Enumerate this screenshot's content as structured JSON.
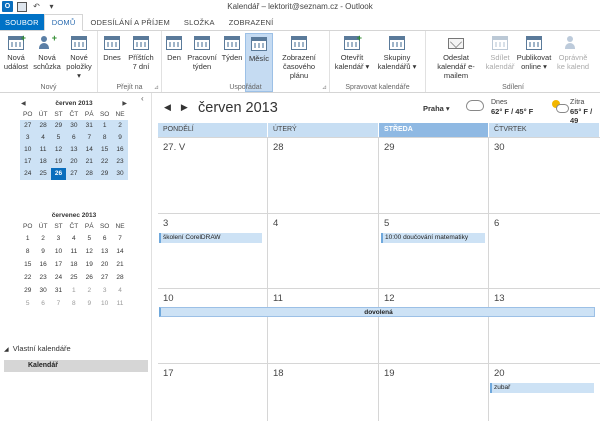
{
  "window": {
    "title": "Kalendář – lektorit@seznam.cz - Outlook"
  },
  "quick_access": {
    "undo_glyph": "↶",
    "dropdown_glyph": "▾"
  },
  "ribbon_tabs": [
    {
      "label": "SOUBOR"
    },
    {
      "label": "DOMŮ"
    },
    {
      "label": "ODESÍLÁNÍ A PŘÍJEM"
    },
    {
      "label": "SLOŽKA"
    },
    {
      "label": "ZOBRAZENÍ"
    }
  ],
  "ribbon": {
    "new": {
      "label": "Nový",
      "new_event": "Nová událost",
      "new_meeting": "Nová schůzka",
      "new_items": "Nové položky ▾"
    },
    "goto": {
      "label": "Přejít na",
      "today": "Dnes",
      "next7": "Příštích 7 dní"
    },
    "arrange": {
      "label": "Uspořádat",
      "day": "Den",
      "work_week": "Pracovní týden",
      "week": "Týden",
      "month": "Měsíc",
      "schedule": "Zobrazení časového plánu"
    },
    "manage": {
      "label": "Spravovat kalendáře",
      "open": "Otevřít kalendář ▾",
      "groups": "Skupiny kalendářů ▾"
    },
    "share": {
      "label": "Sdílení",
      "email": "Odeslat kalendář e-mailem",
      "share": "Sdílet kalendář",
      "publish": "Publikovat online ▾",
      "permissions": "Oprávně ke kalend"
    }
  },
  "mini_cal_1": {
    "title": "červen 2013",
    "prev": "◀",
    "next": "▶",
    "days": [
      "PO",
      "ÚT",
      "ST",
      "ČT",
      "PÁ",
      "SO",
      "NE"
    ],
    "weeks": [
      [
        "27",
        "28",
        "29",
        "30",
        "31",
        "1",
        "2"
      ],
      [
        "3",
        "4",
        "5",
        "6",
        "7",
        "8",
        "9"
      ],
      [
        "10",
        "11",
        "12",
        "13",
        "14",
        "15",
        "16"
      ],
      [
        "17",
        "18",
        "19",
        "20",
        "21",
        "22",
        "23"
      ],
      [
        "24",
        "25",
        "26",
        "27",
        "28",
        "29",
        "30"
      ]
    ]
  },
  "mini_cal_2": {
    "title": "červenec 2013",
    "days": [
      "PO",
      "ÚT",
      "ST",
      "ČT",
      "PÁ",
      "SO",
      "NE"
    ],
    "weeks": [
      [
        "1",
        "2",
        "3",
        "4",
        "5",
        "6",
        "7"
      ],
      [
        "8",
        "9",
        "10",
        "11",
        "12",
        "13",
        "14"
      ],
      [
        "15",
        "16",
        "17",
        "18",
        "19",
        "20",
        "21"
      ],
      [
        "22",
        "23",
        "24",
        "25",
        "26",
        "27",
        "28"
      ],
      [
        "29",
        "30",
        "31",
        "1",
        "2",
        "3",
        "4"
      ],
      [
        "5",
        "6",
        "7",
        "8",
        "9",
        "10",
        "11"
      ]
    ]
  },
  "left_pane": {
    "collapse_glyph": "‹",
    "section_label": "Vlastní kalendáře",
    "section_glyph": "◢",
    "calendar_name": "Kalendář"
  },
  "main": {
    "prev_glyph": "◀",
    "next_glyph": "▶",
    "month_title": "červen 2013",
    "city": "Praha ▾",
    "today_label": "Dnes",
    "today_temp": "62° F / 45° F",
    "tomorrow_label": "Zítra",
    "tomorrow_temp": "65° F / 49",
    "day_headers": [
      "PONDĚLÍ",
      "ÚTERÝ",
      "STŘEDA",
      "ČTVRTEK"
    ],
    "weeks": [
      [
        "27. V",
        "28",
        "29",
        "30"
      ],
      [
        "3",
        "4",
        "5",
        "6"
      ],
      [
        "10",
        "11",
        "12",
        "13"
      ],
      [
        "17",
        "18",
        "19",
        "20"
      ]
    ],
    "events": {
      "corel": "školení CorelDRAW",
      "tutoring": "10:00 doučování matematiky",
      "vacation": "dovolená",
      "dentist": "zubař"
    }
  },
  "colors": {
    "accent": "#0072c6",
    "today_fill": "#0a6ebd",
    "header_fill": "#c7def3",
    "current_day_header": "#8fb9e3",
    "event_fill": "#cde2f5"
  }
}
